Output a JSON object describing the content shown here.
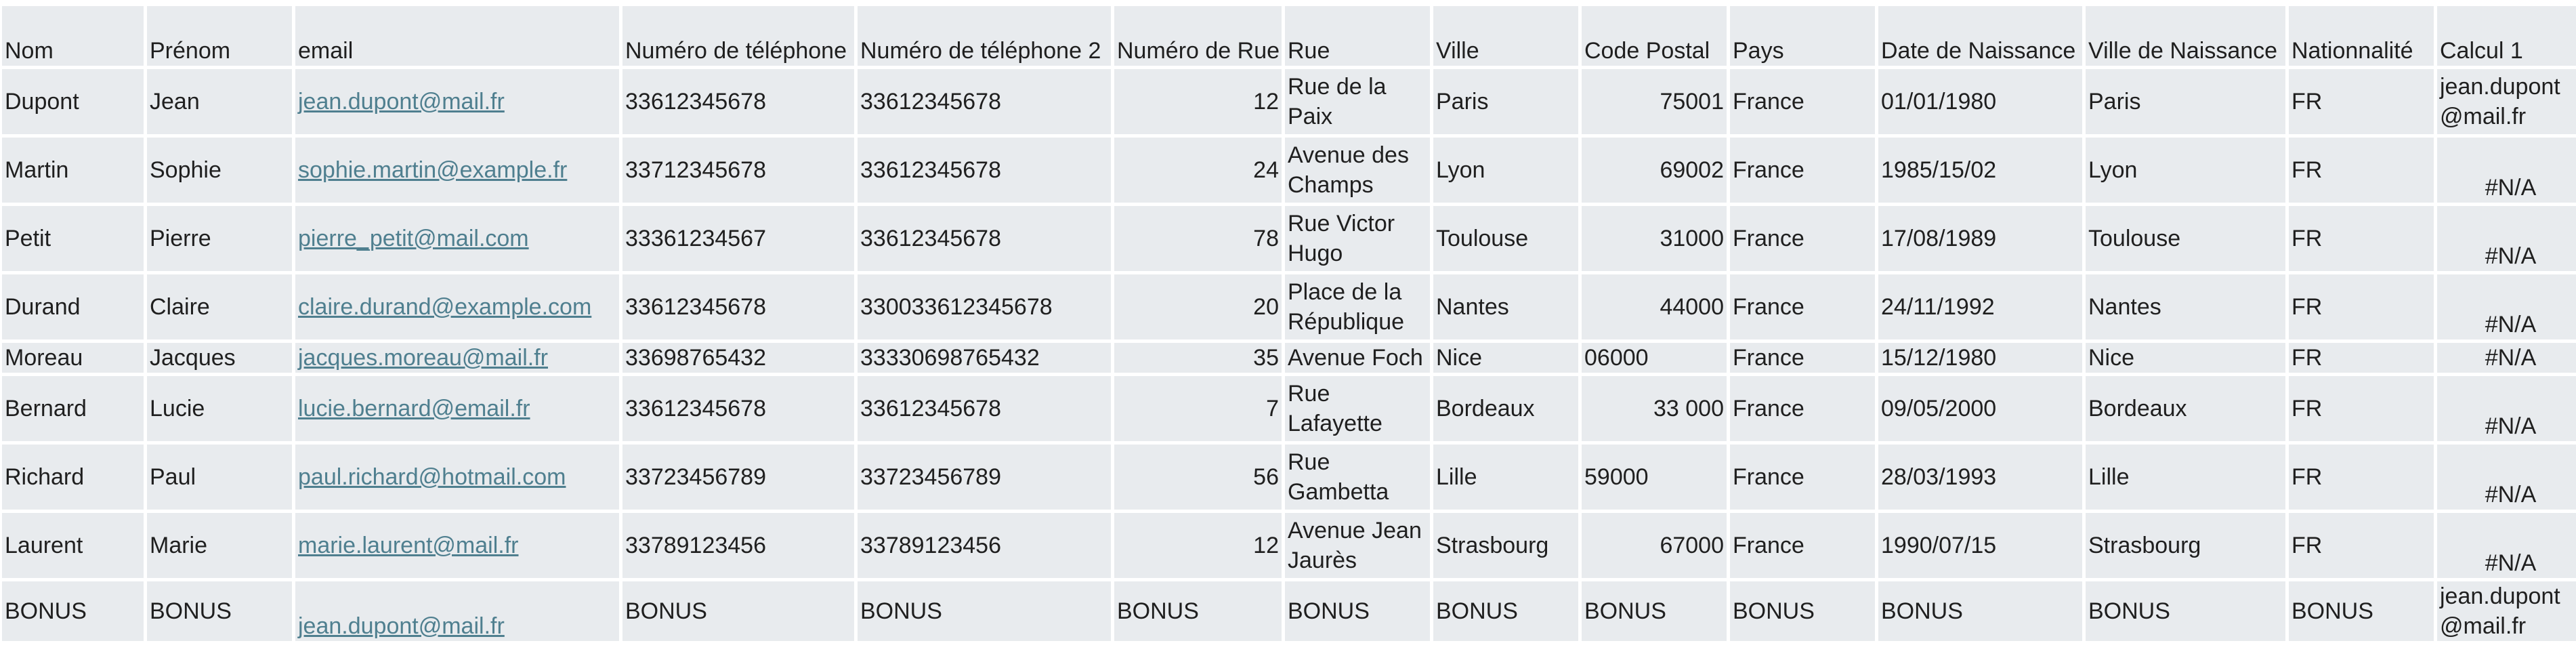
{
  "headers": [
    "Nom",
    "Prénom",
    "email",
    "Numéro de téléphone",
    "Numéro de téléphone 2",
    "Numéro de Rue",
    "Rue",
    "Ville",
    "Code Postal",
    "Pays",
    "Date de Naissance",
    "Ville de Naissance",
    "Nationnalité",
    "Calcul 1"
  ],
  "rows": [
    [
      "Dupont",
      "Jean",
      "jean.dupont@mail.fr",
      "33612345678",
      "33612345678",
      "12",
      "Rue de la Paix",
      "Paris",
      "75001",
      "France",
      "01/01/1980",
      "Paris",
      "FR",
      "jean.dupont@mail.fr"
    ],
    [
      "Martin",
      "Sophie",
      "sophie.martin@example.fr",
      "33712345678",
      "33612345678",
      "24",
      "Avenue des Champs",
      "Lyon",
      "69002",
      "France",
      "1985/15/02",
      "Lyon",
      "FR",
      "#N/A"
    ],
    [
      "Petit",
      "Pierre",
      "pierre_petit@mail.com",
      "33361234567",
      "33612345678",
      "78",
      "Rue Victor Hugo",
      "Toulouse",
      "31000",
      "France",
      "17/08/1989",
      "Toulouse",
      "FR",
      "#N/A"
    ],
    [
      "Durand",
      "Claire",
      "claire.durand@example.com",
      "33612345678",
      "330033612345678",
      "20",
      "Place de la République",
      "Nantes",
      "44000",
      "France",
      "24/11/1992",
      "Nantes",
      "FR",
      "#N/A"
    ],
    [
      "Moreau",
      "Jacques",
      "jacques.moreau@mail.fr",
      "33698765432",
      "33330698765432",
      "35",
      "Avenue Foch",
      "Nice",
      "06000",
      "France",
      "15/12/1980",
      "Nice",
      "FR",
      "#N/A"
    ],
    [
      "Bernard",
      "Lucie",
      "lucie.bernard@email.fr",
      "33612345678",
      "33612345678",
      "7",
      "Rue Lafayette",
      "Bordeaux",
      "33 000",
      "France",
      "09/05/2000",
      "Bordeaux",
      "FR",
      "#N/A"
    ],
    [
      "Richard",
      "Paul",
      "paul.richard@hotmail.com",
      "33723456789",
      "33723456789",
      "56",
      "Rue Gambetta",
      "Lille",
      "59000",
      "France",
      "28/03/1993",
      "Lille",
      "FR",
      "#N/A"
    ],
    [
      "Laurent",
      "Marie",
      "marie.laurent@mail.fr",
      "33789123456",
      "33789123456",
      "12",
      "Avenue Jean Jaurès",
      "Strasbourg",
      "67000",
      "France",
      "1990/07/15",
      "Strasbourg",
      "FR",
      "#N/A"
    ],
    [
      "BONUS",
      "BONUS",
      "jean.dupont@mail.fr",
      "BONUS",
      "BONUS",
      "BONUS",
      "BONUS",
      "BONUS",
      "BONUS",
      "BONUS",
      "BONUS",
      "BONUS",
      "BONUS",
      "jean.dupont@mail.fr"
    ]
  ]
}
